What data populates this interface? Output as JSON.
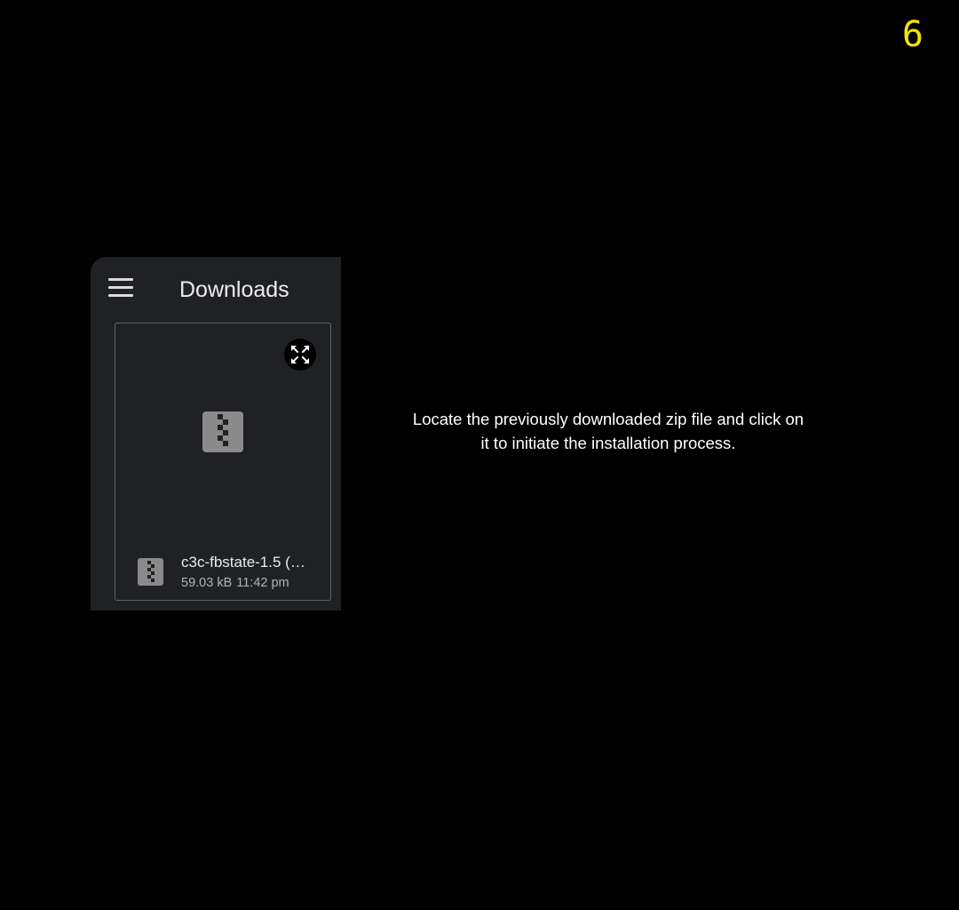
{
  "step_number": "6",
  "app_bar": {
    "menu_icon": "hamburger-menu-icon",
    "title": "Downloads"
  },
  "file_card": {
    "expand_icon": "expand-arrows-icon",
    "preview_icon": "zip-archive-icon",
    "file": {
      "icon": "zip-archive-icon",
      "name": "c3c-fbstate-1.5 (…",
      "size": "59.03 kB",
      "time": "11:42 pm"
    }
  },
  "instruction": "Locate the previously downloaded zip file and click on it to initiate the installation process.",
  "colors": {
    "background": "#000000",
    "step_number": "#f5e400",
    "app_surface": "#202124",
    "card_border": "#5f6368",
    "zip_icon": "#8a8a8a",
    "zip_teeth": "#202124"
  }
}
